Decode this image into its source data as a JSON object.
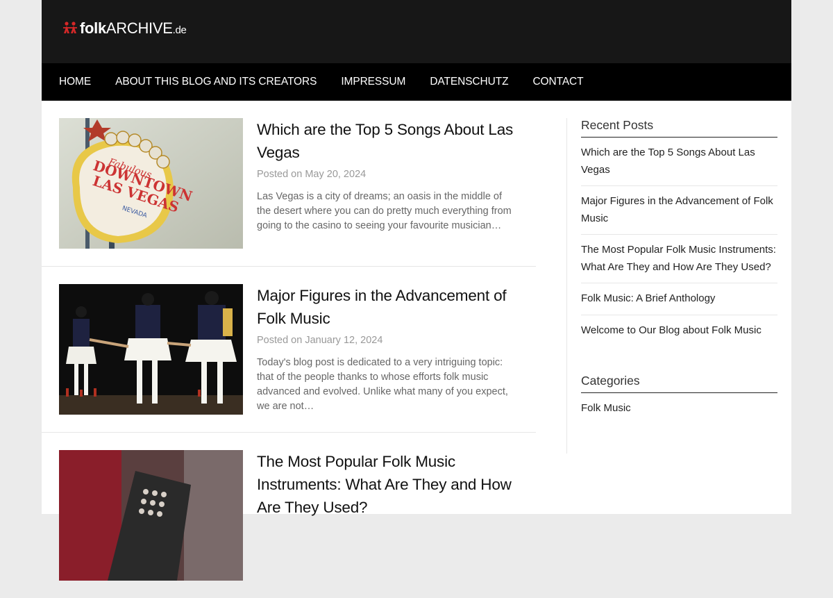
{
  "logo": {
    "bold": "folk",
    "archive": "ARCHIVE",
    "tld": ".de"
  },
  "nav": [
    "HOME",
    "ABOUT THIS BLOG AND ITS CREATORS",
    "IMPRESSUM",
    "DATENSCHUTZ",
    "CONTACT"
  ],
  "posts": [
    {
      "title": "Which are the Top 5 Songs About Las Vegas",
      "date": "Posted on May 20, 2024",
      "excerpt": "Las Vegas is a city of dreams; an oasis in the middle of the desert where you can do pretty much everything from going to the casino to seeing your favourite musician…",
      "image": "Welcome to Fabulous Downtown Las Vegas Nevada sign"
    },
    {
      "title": "Major Figures in the Advancement of Folk Music",
      "date": "Posted on January 12, 2024",
      "excerpt": "Today's blog post is dedicated to a very intriguing topic: that of the people thanks to whose efforts folk music advanced and evolved. Unlike what many of you expect, we are not…",
      "image": "folk dancers in traditional costumes holding hands"
    },
    {
      "title": "The Most Popular Folk Music Instruments: What Are They and How Are They Used?",
      "date": "",
      "excerpt": "",
      "image": "accordion player"
    }
  ],
  "sidebar": {
    "recent_title": "Recent Posts",
    "recent": [
      "Which are the Top 5 Songs About Las Vegas",
      "Major Figures in the Advancement of Folk Music",
      "The Most Popular Folk Music Instruments: What Are They and How Are They Used?",
      "Folk Music: A Brief Anthology",
      "Welcome to Our Blog about Folk Music"
    ],
    "categories_title": "Categories",
    "categories": [
      "Folk Music"
    ]
  },
  "colors": {
    "header_bg": "#171717",
    "nav_bg": "#000000",
    "logo_red": "#d62828",
    "page_bg": "#ebebeb"
  }
}
